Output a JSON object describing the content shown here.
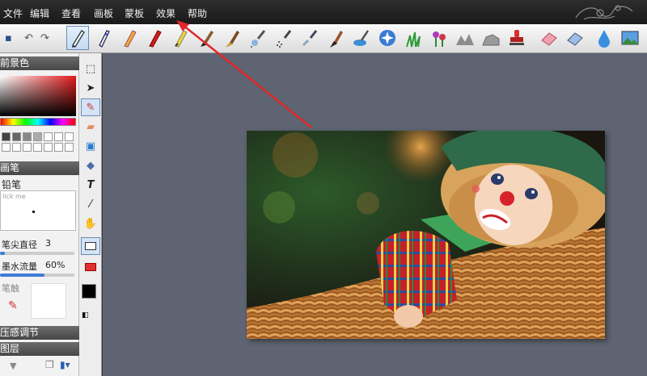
{
  "menu": {
    "items": [
      {
        "id": "file",
        "label": "文件"
      },
      {
        "id": "edit",
        "label": "编辑"
      },
      {
        "id": "view",
        "label": "查看"
      },
      {
        "id": "palette",
        "label": "画板"
      },
      {
        "id": "mask",
        "label": "蒙板"
      },
      {
        "id": "effects",
        "label": "效果"
      },
      {
        "id": "help",
        "label": "帮助"
      }
    ]
  },
  "toolbar": {
    "quick": [
      {
        "icon": "save-icon",
        "glyph": "💾"
      },
      {
        "icon": "undo-icon",
        "glyph": "↶"
      },
      {
        "icon": "redo-icon",
        "glyph": "↷"
      }
    ]
  },
  "left": {
    "fg_title": "前景色",
    "brush_title": "画笔",
    "brush_name": "铅笔",
    "preview_hint": "lick me",
    "tip_diameter_label": "笔尖直径",
    "tip_diameter_value": "3",
    "ink_flow_label": "墨水流量",
    "ink_flow_value": "60%",
    "pen_touch_label": "笔触",
    "pressure_title": "压感调节",
    "layers_title": "图层"
  },
  "colors": {
    "accent": "#3e7bd6",
    "canvas_bg": "#5e6471",
    "arrow": "#e0282a"
  }
}
